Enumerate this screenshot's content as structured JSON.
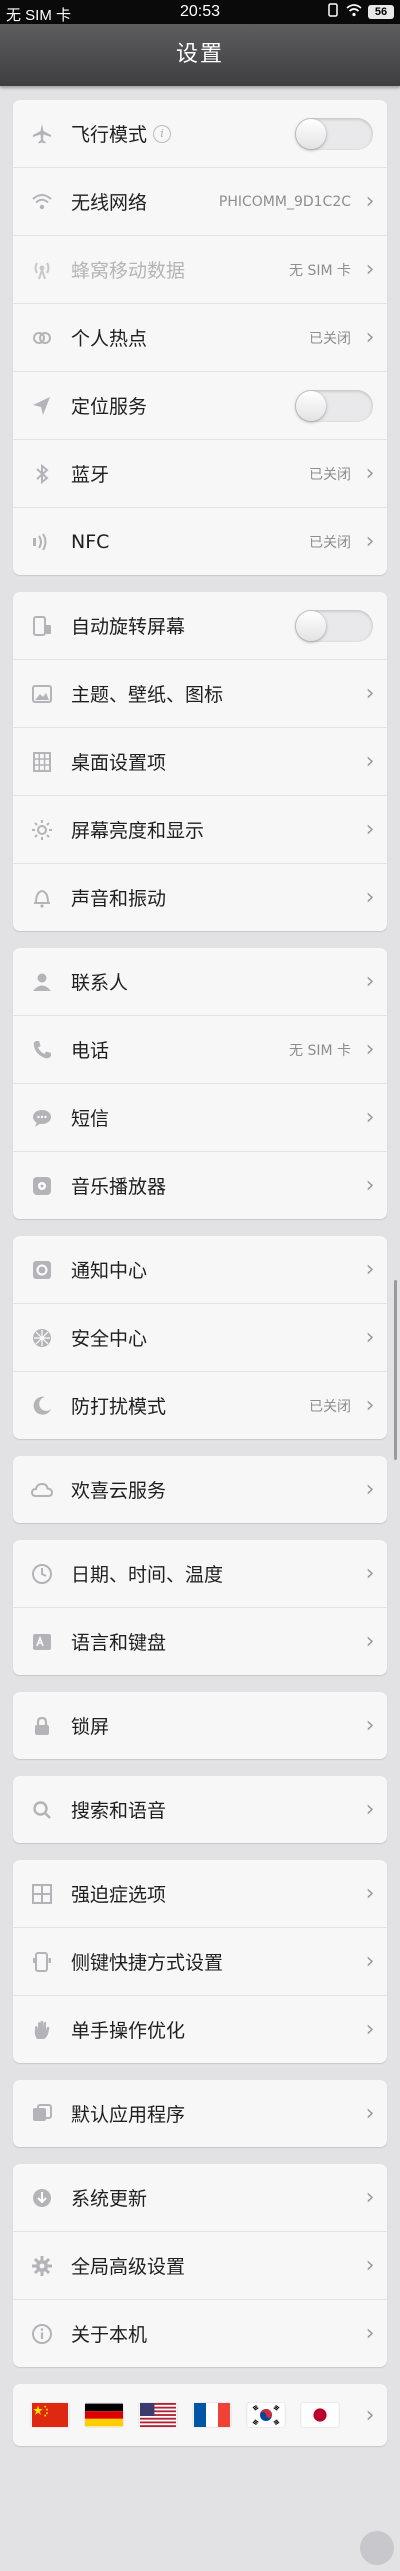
{
  "status_bar": {
    "carrier": "无 SIM 卡",
    "time": "20:53",
    "battery": "56"
  },
  "header": {
    "title": "设置"
  },
  "groups": [
    {
      "rows": [
        {
          "label": "飞行模式",
          "icon": "airplane-icon",
          "control": "toggle",
          "toggle_on": false,
          "info": "i"
        },
        {
          "label": "无线网络",
          "icon": "wifi-icon",
          "status": "PHICOMM_9D1C2C",
          "control": "chevron"
        },
        {
          "label": "蜂窝移动数据",
          "icon": "cellular-icon",
          "status": "无 SIM 卡",
          "control": "chevron",
          "disabled": true
        },
        {
          "label": "个人热点",
          "icon": "hotspot-icon",
          "status": "已关闭",
          "control": "chevron"
        },
        {
          "label": "定位服务",
          "icon": "location-icon",
          "control": "toggle",
          "toggle_on": false
        },
        {
          "label": "蓝牙",
          "icon": "bluetooth-icon",
          "status": "已关闭",
          "control": "chevron"
        },
        {
          "label": "NFC",
          "icon": "nfc-icon",
          "status": "已关闭",
          "control": "chevron"
        }
      ]
    },
    {
      "rows": [
        {
          "label": "自动旋转屏幕",
          "icon": "rotate-icon",
          "control": "toggle",
          "toggle_on": false
        },
        {
          "label": "主题、壁纸、图标",
          "icon": "image-icon",
          "control": "chevron"
        },
        {
          "label": "桌面设置项",
          "icon": "grid-icon",
          "control": "chevron"
        },
        {
          "label": "屏幕亮度和显示",
          "icon": "brightness-icon",
          "control": "chevron"
        },
        {
          "label": "声音和振动",
          "icon": "bell-icon",
          "control": "chevron"
        }
      ]
    },
    {
      "rows": [
        {
          "label": "联系人",
          "icon": "contact-icon",
          "control": "chevron"
        },
        {
          "label": "电话",
          "icon": "phone-icon",
          "status": "无 SIM 卡",
          "control": "chevron"
        },
        {
          "label": "短信",
          "icon": "message-icon",
          "control": "chevron"
        },
        {
          "label": "音乐播放器",
          "icon": "music-icon",
          "control": "chevron"
        }
      ]
    },
    {
      "rows": [
        {
          "label": "通知中心",
          "icon": "notification-icon",
          "control": "chevron"
        },
        {
          "label": "安全中心",
          "icon": "security-icon",
          "control": "chevron"
        },
        {
          "label": "防打扰模式",
          "icon": "moon-icon",
          "status": "已关闭",
          "control": "chevron"
        }
      ]
    },
    {
      "rows": [
        {
          "label": "欢喜云服务",
          "icon": "cloud-icon",
          "control": "chevron"
        }
      ]
    },
    {
      "rows": [
        {
          "label": "日期、时间、温度",
          "icon": "clock-icon",
          "control": "chevron"
        },
        {
          "label": "语言和键盘",
          "icon": "language-icon",
          "control": "chevron"
        }
      ]
    },
    {
      "rows": [
        {
          "label": "锁屏",
          "icon": "lock-icon",
          "control": "chevron"
        }
      ]
    },
    {
      "rows": [
        {
          "label": "搜索和语音",
          "icon": "search-icon",
          "control": "chevron"
        }
      ]
    },
    {
      "rows": [
        {
          "label": "强迫症选项",
          "icon": "tiles-icon",
          "control": "chevron"
        },
        {
          "label": "侧键快捷方式设置",
          "icon": "side-key-icon",
          "control": "chevron"
        },
        {
          "label": "单手操作优化",
          "icon": "hand-icon",
          "control": "chevron"
        }
      ]
    },
    {
      "rows": [
        {
          "label": "默认应用程序",
          "icon": "default-apps-icon",
          "control": "chevron"
        }
      ]
    },
    {
      "rows": [
        {
          "label": "系统更新",
          "icon": "download-icon",
          "control": "chevron"
        },
        {
          "label": "全局高级设置",
          "icon": "gear-icon",
          "control": "chevron"
        },
        {
          "label": "关于本机",
          "icon": "info-icon",
          "control": "chevron"
        }
      ]
    }
  ],
  "flags": [
    "china-flag",
    "germany-flag",
    "usa-flag",
    "france-flag",
    "korea-flag",
    "japan-flag"
  ],
  "colors": {
    "header_bg": "#4a4a4c",
    "page_bg": "#e2e2e5",
    "card_bg": "#f7f7f8",
    "icon_gray": "#b4b4b8"
  }
}
